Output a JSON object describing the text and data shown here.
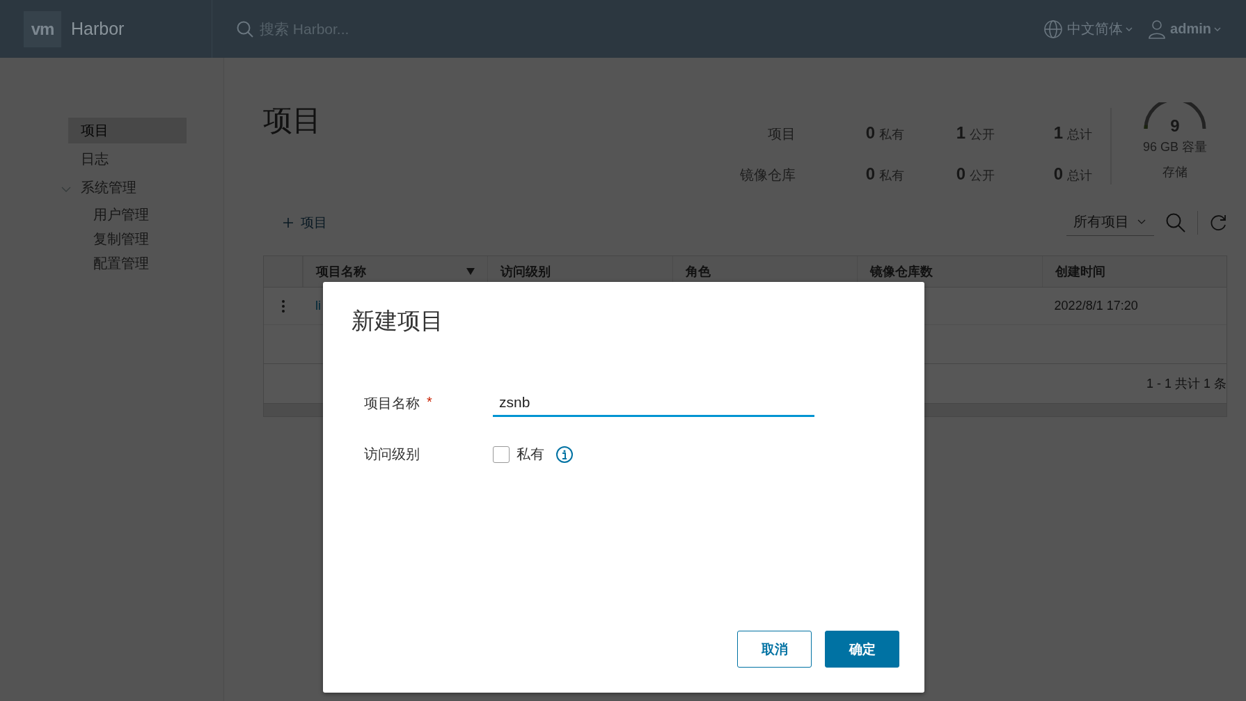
{
  "header": {
    "logo": "vm",
    "brand": "Harbor",
    "search": {
      "placeholder": "搜索 Harbor..."
    },
    "language": "中文简体",
    "user": "admin"
  },
  "sidebar": {
    "items": [
      {
        "label": "项目",
        "selected": true
      },
      {
        "label": "日志",
        "selected": false
      },
      {
        "label": "系统管理",
        "selected": false,
        "expanded": true,
        "children": [
          {
            "label": "用户管理",
            "selected": false
          },
          {
            "label": "复制管理",
            "selected": false
          },
          {
            "label": "配置管理",
            "selected": false
          }
        ]
      }
    ]
  },
  "page": {
    "title": "项目"
  },
  "stats": {
    "rows": [
      {
        "label": "项目",
        "cells": [
          {
            "value": "0",
            "unit": "私有"
          },
          {
            "value": "1",
            "unit": "公开"
          },
          {
            "value": "1",
            "unit": "总计"
          }
        ]
      },
      {
        "label": "镜像仓库",
        "cells": [
          {
            "value": "0",
            "unit": "私有"
          },
          {
            "value": "0",
            "unit": "公开"
          },
          {
            "value": "0",
            "unit": "总计"
          }
        ]
      }
    ]
  },
  "storage": {
    "value": "9",
    "capacity": "96 GB 容量",
    "label": "存储",
    "level": 0.04
  },
  "toolbar": {
    "add_label": "项目",
    "filter": "所有项目"
  },
  "table": {
    "columns": [
      {
        "label": "项目名称",
        "filterable": true
      },
      {
        "label": "访问级别",
        "filterable": false
      },
      {
        "label": "角色",
        "filterable": false
      },
      {
        "label": "镜像仓库数",
        "filterable": false
      },
      {
        "label": "创建时间",
        "filterable": false
      }
    ],
    "rows": [
      {
        "name": "li",
        "created": "2022/8/1 17:20"
      }
    ],
    "footer": "1 - 1 共计 1 条"
  },
  "dialog": {
    "title": "新建项目",
    "fields": [
      {
        "kind": "text",
        "label": "项目名称",
        "required_mark": "*",
        "value": "zsnb"
      },
      {
        "kind": "checkbox",
        "label": "访问级别",
        "option": "私有",
        "checked": false
      }
    ],
    "buttons": [
      {
        "label": "取消",
        "primary": false
      },
      {
        "label": "确定",
        "primary": true
      }
    ]
  }
}
